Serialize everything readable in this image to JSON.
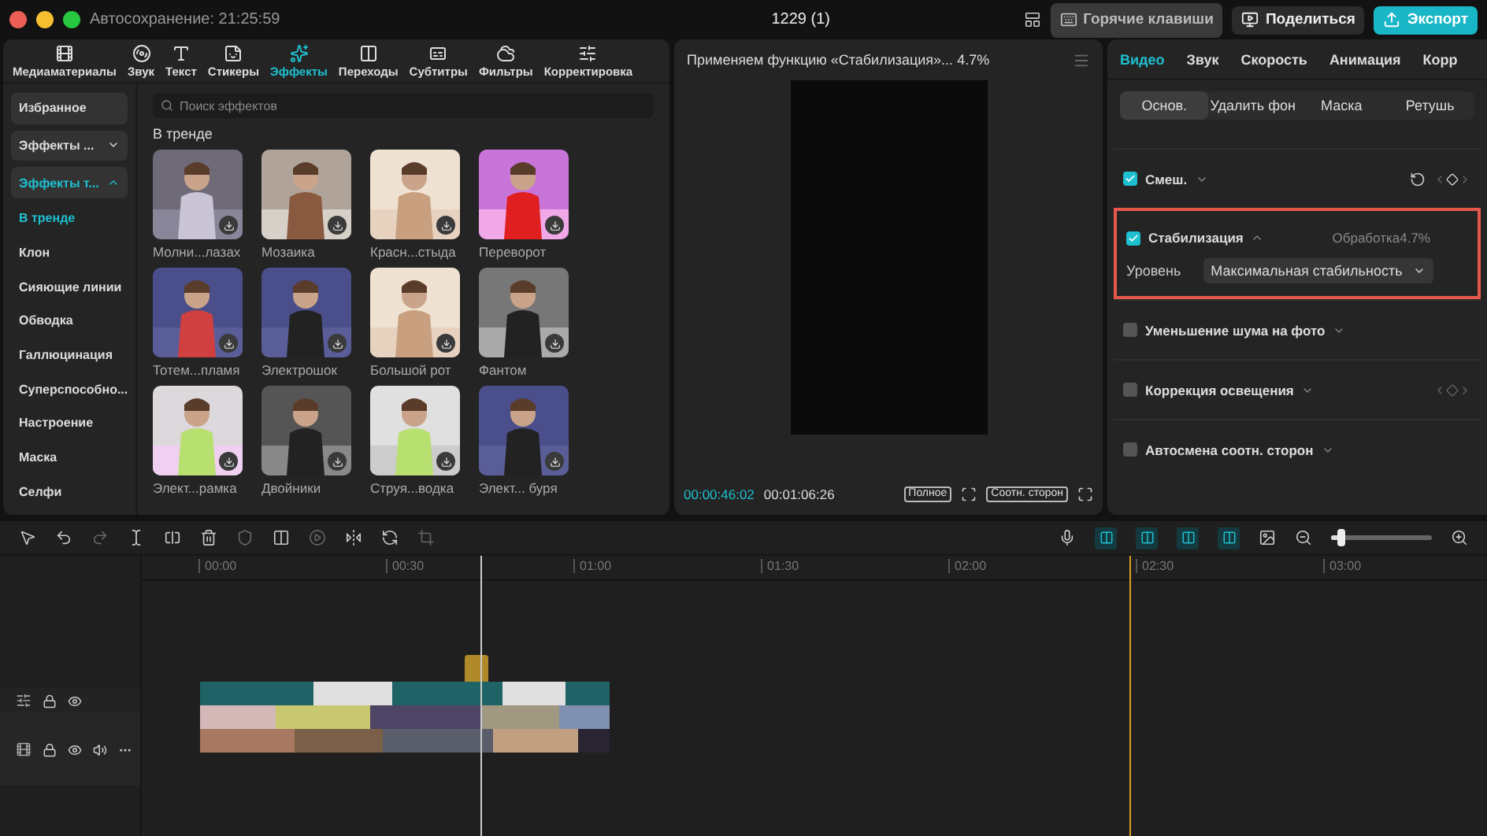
{
  "window": {
    "autosave": "Автосохранение: 21:25:59",
    "project_title": "1229 (1)"
  },
  "top_buttons": [
    {
      "kind": "hotkeys",
      "label": "Горячие клавиши"
    },
    {
      "kind": "share",
      "label": "Поделиться"
    },
    {
      "kind": "export",
      "label": "Экспорт"
    }
  ],
  "toolbar": [
    {
      "kind": "media",
      "label": "Медиаматериалы",
      "selected": false
    },
    {
      "kind": "audio",
      "label": "Звук",
      "selected": false
    },
    {
      "kind": "text",
      "label": "Текст",
      "selected": false
    },
    {
      "kind": "stickers",
      "label": "Стикеры",
      "selected": false
    },
    {
      "kind": "effects",
      "label": "Эффекты",
      "selected": true
    },
    {
      "kind": "transitions",
      "label": "Переходы",
      "selected": false
    },
    {
      "kind": "captions",
      "label": "Субтитры",
      "selected": false
    },
    {
      "kind": "filters",
      "label": "Фильтры",
      "selected": false
    },
    {
      "kind": "adjust",
      "label": "Корректировка",
      "selected": false
    }
  ],
  "sidebar": [
    {
      "kind": "button",
      "label": "Избранное",
      "selected": false
    },
    {
      "kind": "group",
      "label": "Эффекты ...",
      "expanded": false,
      "selected": false
    },
    {
      "kind": "group",
      "label": "Эффекты т...",
      "expanded": true,
      "selected": true
    },
    {
      "kind": "item",
      "label": "В тренде",
      "selected": true
    },
    {
      "kind": "item",
      "label": "Клон",
      "selected": false
    },
    {
      "kind": "item",
      "label": "Сияющие линии",
      "selected": false
    },
    {
      "kind": "item",
      "label": "Обводка",
      "selected": false
    },
    {
      "kind": "item",
      "label": "Галлюцинация",
      "selected": false
    },
    {
      "kind": "item",
      "label": "Суперспособно...",
      "selected": false
    },
    {
      "kind": "item",
      "label": "Настроение",
      "selected": false
    },
    {
      "kind": "item",
      "label": "Маска",
      "selected": false
    },
    {
      "kind": "item",
      "label": "Селфи",
      "selected": false
    }
  ],
  "search": {
    "placeholder": "Поиск эффектов"
  },
  "section_title": "В тренде",
  "effects": [
    {
      "label": "Молни...лазах"
    },
    {
      "label": "Мозаика"
    },
    {
      "label": "Красн...стыда"
    },
    {
      "label": "Переворот"
    },
    {
      "label": "Тотем...пламя"
    },
    {
      "label": "Электрошок"
    },
    {
      "label": "Большой рот"
    },
    {
      "label": "Фантом"
    },
    {
      "label": "Элект...рамка"
    },
    {
      "label": "Двойники"
    },
    {
      "label": "Струя...водка"
    },
    {
      "label": "Элект... буря"
    }
  ],
  "preview": {
    "title": "Применяем функцию «Стабилизация»... 4.7%",
    "current_time": "00:00:46:02",
    "duration": "00:01:06:26",
    "full_button": "Полное",
    "ratio_button": "Соотн. сторон"
  },
  "inspector": {
    "tabs": [
      {
        "label": "Видео",
        "selected": true
      },
      {
        "label": "Звук",
        "selected": false
      },
      {
        "label": "Скорость",
        "selected": false
      },
      {
        "label": "Анимация",
        "selected": false
      },
      {
        "label": "Корр",
        "selected": false
      }
    ],
    "subtabs": [
      {
        "label": "Основ.",
        "selected": true
      },
      {
        "label": "Удалить фон",
        "selected": false
      },
      {
        "label": "Маска",
        "selected": false
      },
      {
        "label": "Ретушь",
        "selected": false
      }
    ],
    "sections": [
      {
        "kind": "blend",
        "title": "Смеш.",
        "checked": true,
        "expanded": false
      },
      {
        "kind": "stabilize",
        "title": "Стабилизация",
        "checked": true,
        "expanded": true,
        "highlighted": true,
        "status": "Обработка4.7%",
        "field_label": "Уровень",
        "field_value": "Максимальная стабильность"
      },
      {
        "kind": "plain",
        "title": "Уменьшение шума на фото",
        "checked": false,
        "expanded": false
      },
      {
        "kind": "keyframe",
        "title": "Коррекция освещения",
        "checked": false,
        "expanded": false
      },
      {
        "kind": "plain",
        "title": "Автосмена соотн. сторон",
        "checked": false,
        "expanded": false
      }
    ]
  },
  "timeline": {
    "ruler": [
      "00:00",
      "00:30",
      "01:00",
      "01:30",
      "02:00",
      "02:30",
      "03:00"
    ],
    "zoom": {
      "level": 0.1
    }
  }
}
